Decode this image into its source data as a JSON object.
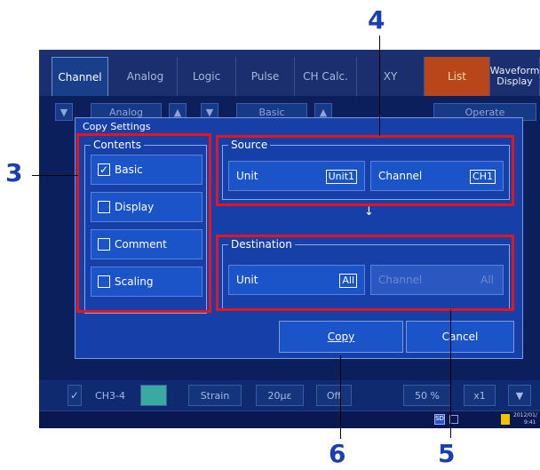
{
  "tabs": [
    {
      "label": "Channel"
    },
    {
      "label": "Analog"
    },
    {
      "label": "Logic"
    },
    {
      "label": "Pulse"
    },
    {
      "label": "CH Calc."
    },
    {
      "label": "XY"
    },
    {
      "label": "List"
    },
    {
      "label": "Waveform Display"
    }
  ],
  "background": {
    "analog_label": "Analog",
    "basic_label": "Basic",
    "operate_label": "Operate",
    "row": {
      "checkbox": "✓",
      "channel": "CH3-4",
      "strain": "Strain",
      "range": "20με",
      "off": "Off",
      "percent": "50 %",
      "mult": "x1"
    }
  },
  "dialog": {
    "title": "Copy Settings",
    "contents": {
      "label": "Contents",
      "items": [
        {
          "label": "Basic",
          "checked": true,
          "mark": "✓"
        },
        {
          "label": "Display",
          "checked": false,
          "mark": ""
        },
        {
          "label": "Comment",
          "checked": false,
          "mark": ""
        },
        {
          "label": "Scaling",
          "checked": false,
          "mark": ""
        }
      ]
    },
    "source": {
      "label": "Source",
      "unit_label": "Unit",
      "unit_value": "Unit1",
      "channel_label": "Channel",
      "channel_value": "CH1"
    },
    "arrow": "↓",
    "destination": {
      "label": "Destination",
      "unit_label": "Unit",
      "unit_value": "All",
      "channel_label": "Channel",
      "channel_value": "All"
    },
    "copy_button": "Copy",
    "cancel_button": "Cancel"
  },
  "status": {
    "date": "2012/01/",
    "time": "9:41"
  },
  "callouts": {
    "c3": "3",
    "c4": "4",
    "c5": "5",
    "c6": "6"
  },
  "colors": {
    "accent": "#1c3fae",
    "highlight": "#e8141c"
  }
}
